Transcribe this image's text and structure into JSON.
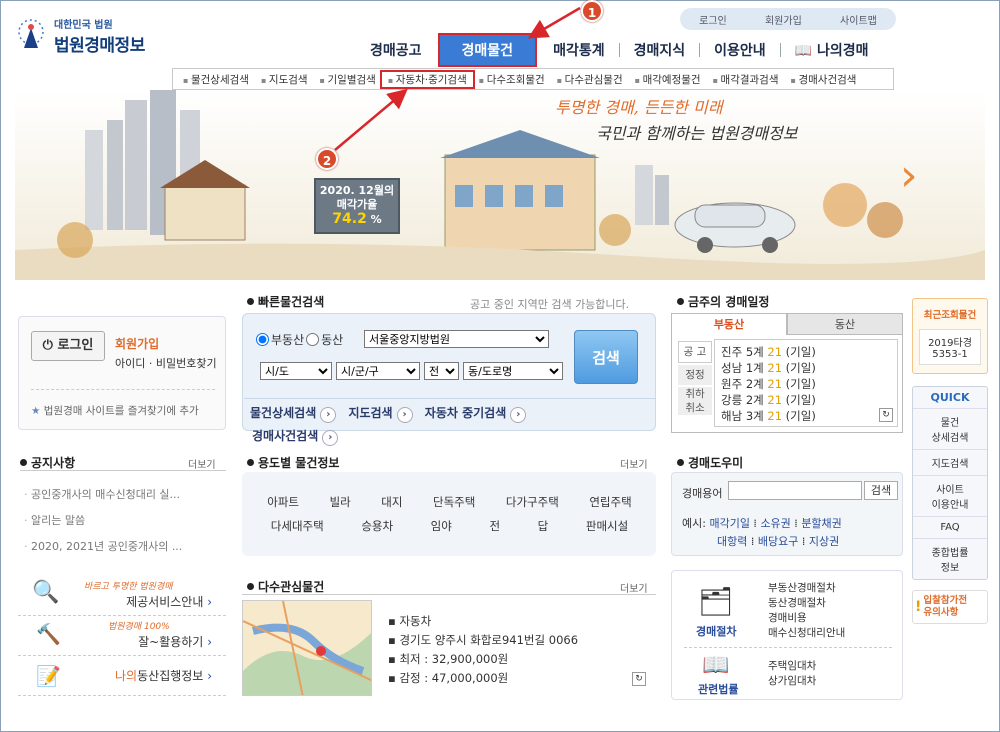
{
  "header": {
    "logo_sub": "대한민국 법원",
    "logo_title": "법원경매정보",
    "top_links": [
      "로그인",
      "회원가입",
      "사이트맵"
    ],
    "main_nav": [
      "경매공고",
      "경매물건",
      "매각통계",
      "경매지식",
      "이용안내",
      "나의경매"
    ],
    "sub_nav": [
      "물건상세검색",
      "지도검색",
      "기일별검색",
      "자동차·중기검색",
      "다수조회물건",
      "다수관심물건",
      "매각예정물건",
      "매각결과검색",
      "경매사건검색"
    ]
  },
  "hero": {
    "slogan1": "투명한 경매, 든든한 미래",
    "slogan2": "국민과 함께하는 법원경매정보",
    "sign_line1": "2020. 12월의",
    "sign_line2": "매각가율",
    "sign_value": "74.2",
    "sign_unit": "%",
    "badge1": "1",
    "badge2": "2"
  },
  "login": {
    "button": "로그인",
    "join": "회원가입",
    "find": "아이디 · 비밀번호찾기",
    "favorite": "법원경매 사이트를 즐겨찾기에 추가"
  },
  "quick_search": {
    "title": "빠른물건검색",
    "note": "공고 중인 지역만 검색 가능합니다.",
    "radio1": "부동산",
    "radio2": "동산",
    "court": "서울중앙지방법원",
    "sido": "시/도",
    "sigungu": "시/군/구",
    "jeon": "전",
    "dong": "동/도로명",
    "search_button": "검색",
    "links": [
      "물건상세검색",
      "지도검색",
      "자동차 중기검색",
      "경매사건검색"
    ]
  },
  "schedule": {
    "title": "금주의 경매일정",
    "tabs": [
      "부동산",
      "동산"
    ],
    "side_labels": [
      "공 고",
      "정정",
      "취하",
      "취소"
    ],
    "rows": [
      {
        "place": "진주 5계",
        "date": "21",
        "tail": "(기일)"
      },
      {
        "place": "성남 1계",
        "date": "21",
        "tail": "(기일)"
      },
      {
        "place": "원주 2계",
        "date": "21",
        "tail": "(기일)"
      },
      {
        "place": "강릉 2계",
        "date": "21",
        "tail": "(기일)"
      },
      {
        "place": "해남 3계",
        "date": "21",
        "tail": "(기일)"
      }
    ]
  },
  "notice": {
    "title": "공지사항",
    "more": "더보기",
    "items": [
      "공인중개사의 매수신청대리 실...",
      "알리는 말씀",
      "2020, 2021년 공인중개사의 ..."
    ]
  },
  "usage": {
    "title": "용도별 물건정보",
    "more": "더보기",
    "row1": [
      "아파트",
      "빌라",
      "대지",
      "단독주택",
      "다가구주택",
      "연립주택"
    ],
    "row2": [
      "다세대주택",
      "승용차",
      "임야",
      "전",
      "답",
      "판매시설"
    ]
  },
  "helper": {
    "title": "경매도우미",
    "label": "경매용어",
    "button": "검색",
    "example_label": "예시:",
    "examples1": [
      "매각기일",
      "소유권",
      "분할채권"
    ],
    "examples2": [
      "대항력",
      "배당요구",
      "지상권"
    ]
  },
  "multi": {
    "title": "다수관심물건",
    "more": "더보기",
    "items": [
      "자동차",
      "경기도 양주시 화합로941번길 0066",
      "최저 : 32,900,000원",
      "감정 : 47,000,000원"
    ]
  },
  "promo": {
    "tag1": "바르고 투명한 법원경매",
    "item1": "제공서비스안내",
    "tag2": "법원경매 100%",
    "item2": "잘~활용하기",
    "item3_prefix": "나의",
    "item3": "동산집행정보"
  },
  "infobox": {
    "label1": "경매절차",
    "links1": [
      "부동산경매절차",
      "동산경매절차",
      "경매비용",
      "매수신청대리안내"
    ],
    "label2": "관련법률",
    "links2": [
      "주택임대차",
      "상가임대차"
    ]
  },
  "sidebar": {
    "recent_title": "최근조회물건",
    "recent_item": "2019타경\n5353-1",
    "quick_title": "QUICK",
    "quick_items": [
      "물건\n상세검색",
      "지도검색",
      "사이트\n이용안내",
      "FAQ",
      "종합법률\n정보"
    ],
    "notice_title": "입찰참가전\n유의사항"
  },
  "colors": {
    "accent": "#3a7bd5",
    "highlight": "#d9262b",
    "orange": "#e06b2a"
  }
}
